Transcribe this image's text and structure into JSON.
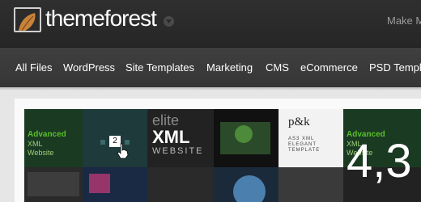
{
  "header": {
    "logo_text": "themeforest",
    "right_link": "Make M"
  },
  "nav": {
    "items": [
      {
        "label": "All Files"
      },
      {
        "label": "WordPress"
      },
      {
        "label": "Site Templates"
      },
      {
        "label": "Marketing"
      },
      {
        "label": "CMS"
      },
      {
        "label": "eCommerce"
      },
      {
        "label": "PSD Templa"
      }
    ]
  },
  "banner": {
    "stat_number": "4,3",
    "tile_texts": {
      "advanced_1": "Advanced",
      "xml_1": "XML",
      "website_1": "Website",
      "page_number": "2",
      "elite": "elite",
      "xml_big": "XML",
      "website_big": "WEBSITE",
      "pk": "p&k",
      "pk_line1": "AS3 XML",
      "pk_line2": "ELEGANT",
      "pk_line3": "TEMPLATE",
      "advanced_2": "Advanced",
      "xml_2": "XML",
      "website_2": "Website"
    }
  },
  "colors": {
    "topbar": "#2a2a2a",
    "navbar": "#3a3a3a",
    "page_bg": "#e6e6e6",
    "advanced_green": "#5bbf2a"
  },
  "icons": {
    "logo": "leaf-logo-icon",
    "dropdown": "chevron-down-icon",
    "cursor": "hand-pointer-icon"
  }
}
